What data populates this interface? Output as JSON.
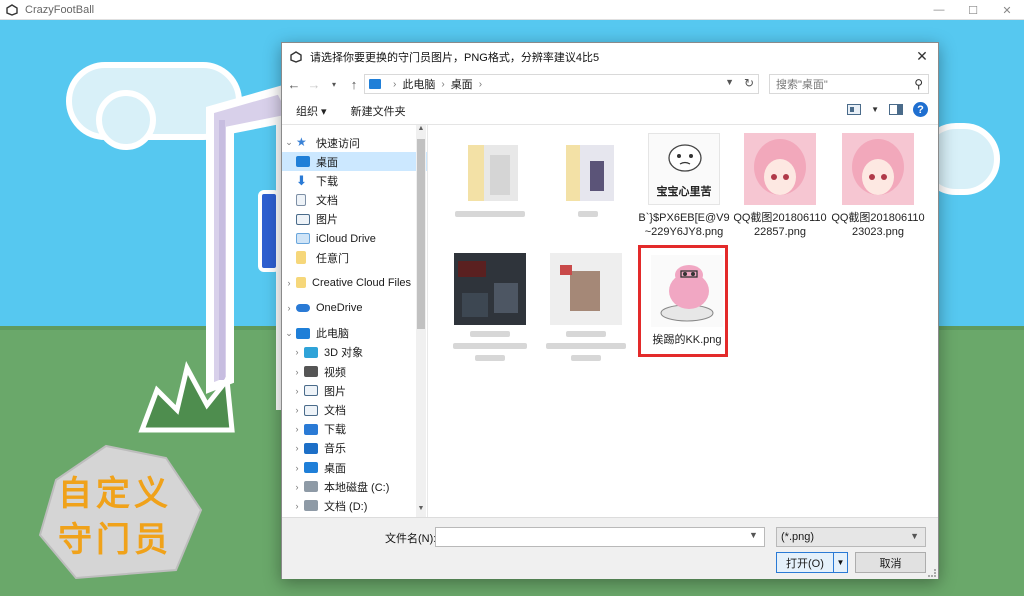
{
  "game": {
    "title": "CrazyFootBall",
    "custom_label_line1": "自定义",
    "custom_label_line2": "守门员",
    "window_minimize": "—",
    "window_maximize": "☐",
    "window_close": "✕"
  },
  "dialog": {
    "title": "请选择你要更换的守门员图片，PNG格式，分辨率建议4比5",
    "close_glyph": "✕",
    "breadcrumb": [
      "此电脑",
      "桌面"
    ],
    "search_placeholder": "搜索\"桌面\"",
    "toolbar": {
      "organize": "组织 ▾",
      "new_folder": "新建文件夹"
    },
    "help": "?",
    "tree": {
      "quick_access": "快速访问",
      "quick_items": [
        {
          "label": "桌面",
          "icon": "desktop-icon",
          "selected": true
        },
        {
          "label": "下载",
          "icon": "download-icon"
        },
        {
          "label": "文档",
          "icon": "document-icon"
        },
        {
          "label": "图片",
          "icon": "pictures-icon"
        },
        {
          "label": "iCloud Drive",
          "icon": "icloud-icon"
        },
        {
          "label": "任意门",
          "icon": "folder-icon"
        }
      ],
      "creative_cloud": "Creative Cloud Files",
      "onedrive": "OneDrive",
      "this_pc": "此电脑",
      "pc_items": [
        {
          "label": "3D 对象",
          "icon": "3d-objects-icon"
        },
        {
          "label": "视频",
          "icon": "video-icon"
        },
        {
          "label": "图片",
          "icon": "pictures-icon"
        },
        {
          "label": "文档",
          "icon": "document-icon"
        },
        {
          "label": "下载",
          "icon": "download-icon"
        },
        {
          "label": "音乐",
          "icon": "music-icon"
        },
        {
          "label": "桌面",
          "icon": "desktop-icon"
        },
        {
          "label": "本地磁盘 (C:)",
          "icon": "drive-icon"
        },
        {
          "label": "文档 (D:)",
          "icon": "drive-icon"
        }
      ]
    },
    "files": [
      {
        "name": "",
        "kind": "folder-blurred"
      },
      {
        "name": "",
        "kind": "folder-blurred"
      },
      {
        "name": "B`}$PX6EB[E@V9~229Y6JY8.png",
        "kind": "sticker",
        "caption": "宝宝心里苦"
      },
      {
        "name": "QQ截图20180611022857.png",
        "kind": "anime"
      },
      {
        "name": "QQ截图20180611023023.png",
        "kind": "anime"
      },
      {
        "name": "",
        "kind": "dark-blurred"
      },
      {
        "name": "",
        "kind": "person-blurred"
      },
      {
        "name": "挨踢的KK.png",
        "kind": "pig",
        "highlighted": true
      }
    ],
    "filename_label": "文件名(N):",
    "filename_value": "",
    "filetype": "(*.png)",
    "open_button": "打开(O)",
    "cancel_button": "取消"
  }
}
